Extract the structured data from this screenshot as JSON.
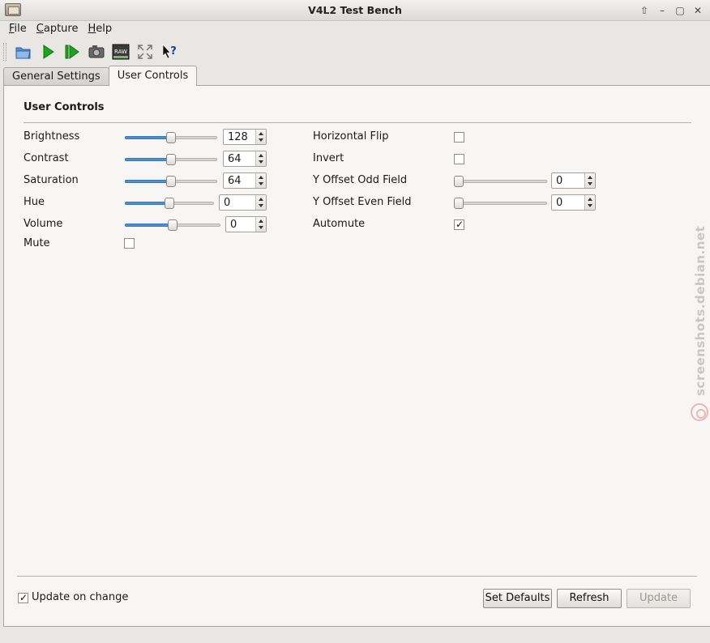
{
  "window": {
    "title": "V4L2 Test Bench"
  },
  "menu": [
    {
      "label": "File",
      "underline": "F",
      "rest": "ile"
    },
    {
      "label": "Capture",
      "underline": "C",
      "rest": "apture"
    },
    {
      "label": "Help",
      "underline": "H",
      "rest": "elp"
    }
  ],
  "toolbar_icons": [
    "open-folder-icon",
    "play-icon",
    "step-play-icon",
    "camera-icon",
    "raw-icon",
    "fullscreen-icon",
    "whats-this-icon"
  ],
  "toolbar": {
    "raw_text": "RAW"
  },
  "tabs": [
    {
      "label": "General Settings",
      "active": false
    },
    {
      "label": "User Controls",
      "active": true
    }
  ],
  "section": {
    "title": "User Controls"
  },
  "left_controls": [
    {
      "label": "Brightness",
      "value": "128",
      "level": 0.5
    },
    {
      "label": "Contrast",
      "value": "64",
      "level": 0.5
    },
    {
      "label": "Saturation",
      "value": "64",
      "level": 0.5
    },
    {
      "label": "Hue",
      "value": "0",
      "level": 0.5
    },
    {
      "label": "Volume",
      "value": "0",
      "level": 0.5
    }
  ],
  "mute": {
    "label": "Mute",
    "checked": false
  },
  "right_controls": {
    "horizontal_flip": {
      "label": "Horizontal Flip",
      "checked": false
    },
    "invert": {
      "label": "Invert",
      "checked": false
    },
    "y_offset_odd": {
      "label": "Y Offset Odd Field",
      "value": "0",
      "level": 0
    },
    "y_offset_even": {
      "label": "Y Offset Even Field",
      "value": "0",
      "level": 0
    },
    "automute": {
      "label": "Automute",
      "checked": true
    }
  },
  "footer": {
    "update_on_change": {
      "label": "Update on change",
      "checked": true
    },
    "set_defaults": "Set Defaults",
    "refresh": "Refresh",
    "update": "Update"
  },
  "watermark": "screenshots.debian.net",
  "colors": {
    "accent": "#4a90d9",
    "play": "#1fa31f"
  }
}
